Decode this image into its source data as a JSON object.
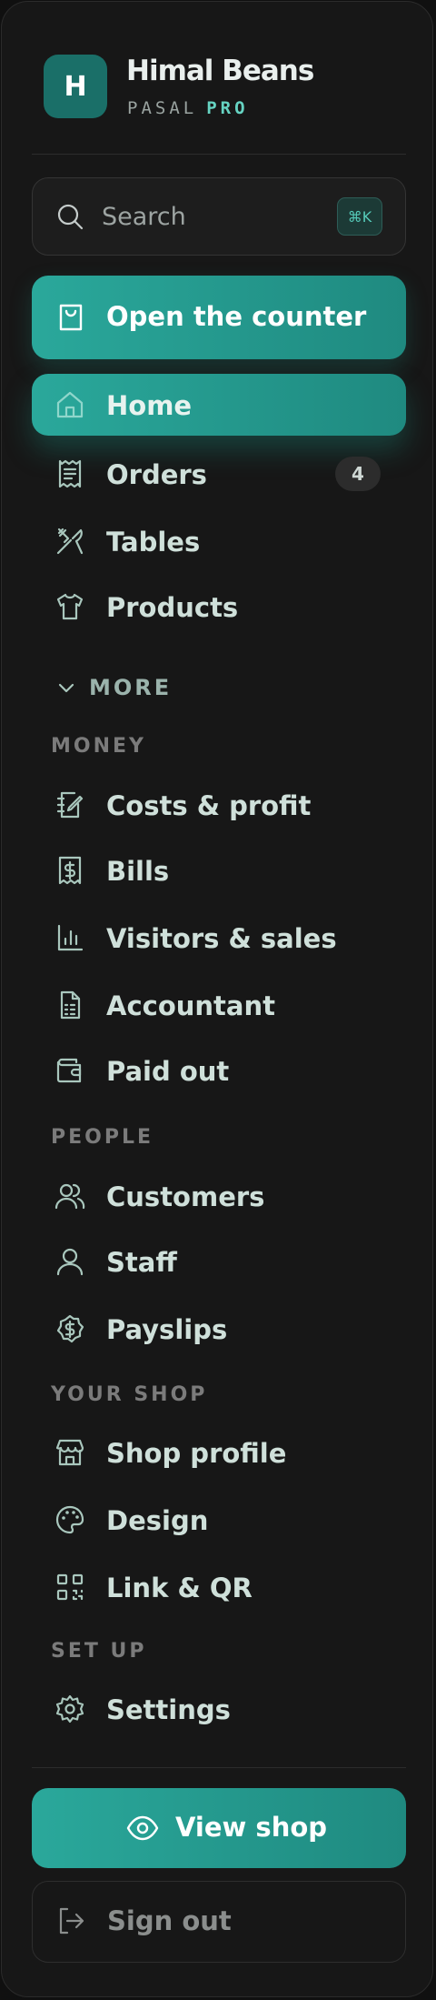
{
  "brand": {
    "logo_letter": "H",
    "name": "Himal Beans",
    "plan": "PASAL",
    "tier": "PRO"
  },
  "search": {
    "placeholder": "Search",
    "shortcut": "⌘K"
  },
  "counter_button": {
    "label": "Open the counter"
  },
  "nav": [
    {
      "label": "Home",
      "icon": "home-icon",
      "active": true
    },
    {
      "label": "Orders",
      "icon": "receipt-icon",
      "badge": "4"
    },
    {
      "label": "Tables",
      "icon": "utensils-icon"
    },
    {
      "label": "Products",
      "icon": "shirt-icon"
    }
  ],
  "more": {
    "label": "MORE",
    "icon": "chevron-down-icon"
  },
  "sections": {
    "money": {
      "title": "MONEY",
      "items": [
        {
          "label": "Costs & profit",
          "icon": "notebook-pen-icon"
        },
        {
          "label": "Bills",
          "icon": "dollar-receipt-icon"
        },
        {
          "label": "Visitors & sales",
          "icon": "bar-chart-icon"
        },
        {
          "label": "Accountant",
          "icon": "spreadsheet-file-icon"
        },
        {
          "label": "Paid out",
          "icon": "wallet-icon"
        }
      ]
    },
    "people": {
      "title": "PEOPLE",
      "items": [
        {
          "label": "Customers",
          "icon": "users-icon"
        },
        {
          "label": "Staff",
          "icon": "user-icon"
        },
        {
          "label": "Payslips",
          "icon": "dollar-badge-icon"
        }
      ]
    },
    "your_shop": {
      "title": "YOUR SHOP",
      "items": [
        {
          "label": "Shop profile",
          "icon": "store-icon"
        },
        {
          "label": "Design",
          "icon": "palette-icon"
        },
        {
          "label": "Link & QR",
          "icon": "qr-code-icon"
        }
      ]
    },
    "set_up": {
      "title": "SET UP",
      "items": [
        {
          "label": "Settings",
          "icon": "gear-icon"
        }
      ]
    }
  },
  "view_shop": {
    "label": "View shop",
    "icon": "eye-icon"
  },
  "sign_out": {
    "label": "Sign out",
    "icon": "log-out-icon"
  },
  "colors": {
    "accent": "#24a093",
    "panel": "#171717",
    "text": "#cfe0da",
    "muted": "#7b7b7b"
  }
}
